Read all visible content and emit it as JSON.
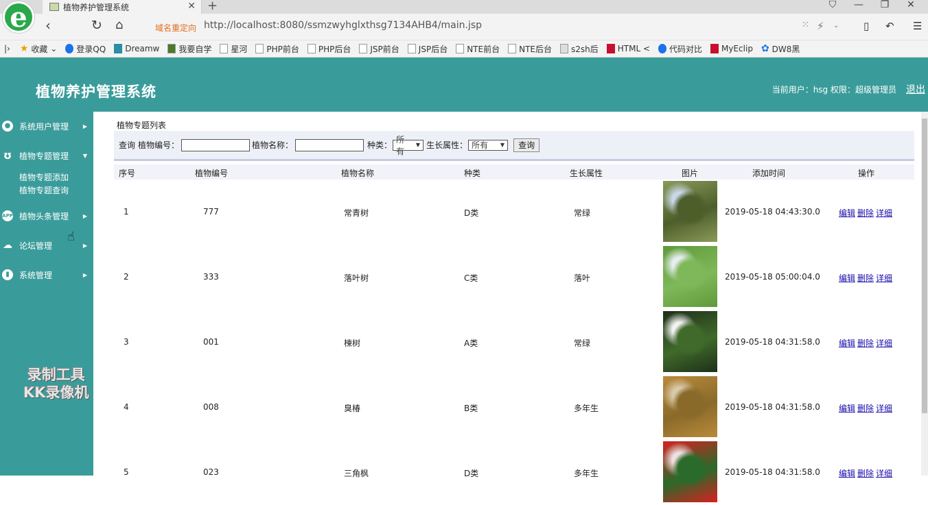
{
  "browser": {
    "tab_title": "植物养护管理系统",
    "tab_close": "✕",
    "new_tab": "+",
    "logo_letter": "e",
    "redirect_label": "域名重定向",
    "url": "http://localhost:8080/ssmzwyhglxthsg7134AHB4/main.jsp",
    "bookmarks": [
      {
        "label": "收藏",
        "icon": "star-icon"
      },
      {
        "label": "登录QQ",
        "icon": "qq-icon"
      },
      {
        "label": "Dreamw",
        "icon": "dreamweaver-icon"
      },
      {
        "label": "我要自学",
        "icon": "page-icon"
      },
      {
        "label": "星河",
        "icon": "page-icon"
      },
      {
        "label": "PHP前台",
        "icon": "page-icon"
      },
      {
        "label": "PHP后台",
        "icon": "page-icon"
      },
      {
        "label": "JSP前台",
        "icon": "page-icon"
      },
      {
        "label": "JSP后台",
        "icon": "page-icon"
      },
      {
        "label": "NTE前台",
        "icon": "page-icon"
      },
      {
        "label": "NTE后台",
        "icon": "page-icon"
      },
      {
        "label": "s2sh后",
        "icon": "image-icon"
      },
      {
        "label": "HTML <",
        "icon": "html-icon"
      },
      {
        "label": "代码对比",
        "icon": "compare-icon"
      },
      {
        "label": "MyEclip",
        "icon": "myeclipse-icon"
      },
      {
        "label": "DW8黑",
        "icon": "paw-icon"
      }
    ]
  },
  "app": {
    "title": "植物养护管理系统",
    "user_info": "当前用户：hsg  权限：超级管理员",
    "logout": "退出"
  },
  "sidebar": {
    "items": [
      {
        "label": "系统用户管理",
        "icon": "user-icon",
        "arrow": "▶"
      },
      {
        "label": "植物专题管理",
        "icon": "plant-icon",
        "arrow": "▼"
      },
      {
        "label": "植物头条管理",
        "icon": "news-icon",
        "arrow": "▶"
      },
      {
        "label": "论坛管理",
        "icon": "cloud-icon",
        "arrow": "▶"
      },
      {
        "label": "系统管理",
        "icon": "chart-icon",
        "arrow": "▶"
      }
    ],
    "subitems": [
      "植物专题添加",
      "植物专题查询"
    ]
  },
  "watermark": {
    "line1": "录制工具",
    "line2": "KK录像机"
  },
  "panel": {
    "title": "植物专题列表",
    "search": {
      "query_label": "查询",
      "code_label": "植物编号：",
      "name_label": "植物名称：",
      "type_label": "种类：",
      "type_value": "所有",
      "growth_label": "生长属性：",
      "growth_value": "所有",
      "button": "查询"
    }
  },
  "table": {
    "headers": [
      "序号",
      "植物编号",
      "植物名称",
      "种类",
      "生长属性",
      "图片",
      "添加时间",
      "操作"
    ],
    "ops": [
      "编辑",
      "删除",
      "详细"
    ],
    "rows": [
      {
        "no": "1",
        "code": "777",
        "name": "常青树",
        "type": "D类",
        "growth": "常绿",
        "time": "2019-05-18 04:43:30.0",
        "img_colors": [
          "#8a9a5b",
          "#c9d8e8",
          "#4d5e2a"
        ]
      },
      {
        "no": "2",
        "code": "333",
        "name": "落叶树",
        "type": "C类",
        "growth": "落叶",
        "time": "2019-05-18 05:00:04.0",
        "img_colors": [
          "#5f9a3a",
          "#e8eef0",
          "#7fb85a"
        ]
      },
      {
        "no": "3",
        "code": "001",
        "name": "楝树",
        "type": "A类",
        "growth": "常绿",
        "time": "2019-05-18 04:31:58.0",
        "img_colors": [
          "#1f2f1a",
          "#f2f2f2",
          "#3f6a2a"
        ]
      },
      {
        "no": "4",
        "code": "008",
        "name": "臭椿",
        "type": "B类",
        "growth": "多年生",
        "time": "2019-05-18 04:31:58.0",
        "img_colors": [
          "#b98a3a",
          "#d9c9a8",
          "#8a6a2a"
        ]
      },
      {
        "no": "5",
        "code": "023",
        "name": "三角枫",
        "type": "D类",
        "growth": "多年生",
        "time": "2019-05-18 04:31:58.0",
        "img_colors": [
          "#d82020",
          "#f0e0e0",
          "#2a6a2a"
        ]
      }
    ]
  }
}
